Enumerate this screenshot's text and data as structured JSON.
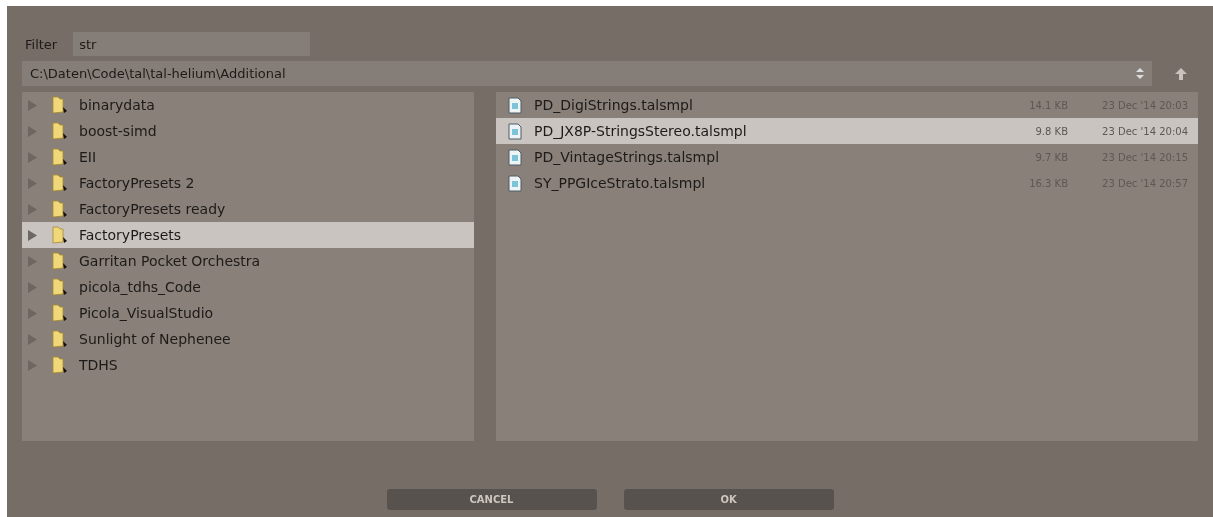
{
  "filter": {
    "label": "Filter",
    "value": "str"
  },
  "path": {
    "value": "C:\\Daten\\Code\\tal\\tal-helium\\Additional"
  },
  "folders": [
    {
      "name": "binarydata",
      "selected": false
    },
    {
      "name": "boost-simd",
      "selected": false
    },
    {
      "name": "EII",
      "selected": false
    },
    {
      "name": "FactoryPresets 2",
      "selected": false
    },
    {
      "name": "FactoryPresets ready",
      "selected": false
    },
    {
      "name": "FactoryPresets",
      "selected": true
    },
    {
      "name": "Garritan Pocket Orchestra",
      "selected": false
    },
    {
      "name": "picola_tdhs_Code",
      "selected": false
    },
    {
      "name": "Picola_VisualStudio",
      "selected": false
    },
    {
      "name": "Sunlight of Nephenee",
      "selected": false
    },
    {
      "name": "TDHS",
      "selected": false
    }
  ],
  "files": [
    {
      "name": "PD_DigiStrings.talsmpl",
      "size": "14.1 KB",
      "date": "23 Dec '14 20:03",
      "selected": false
    },
    {
      "name": "PD_JX8P-StringsStereo.talsmpl",
      "size": "9.8 KB",
      "date": "23 Dec '14 20:04",
      "selected": true
    },
    {
      "name": "PD_VintageStrings.talsmpl",
      "size": "9.7 KB",
      "date": "23 Dec '14 20:15",
      "selected": false
    },
    {
      "name": "SY_PPGIceStrato.talsmpl",
      "size": "16.3 KB",
      "date": "23 Dec '14 20:57",
      "selected": false
    }
  ],
  "buttons": [
    "CANCEL",
    "OK"
  ]
}
